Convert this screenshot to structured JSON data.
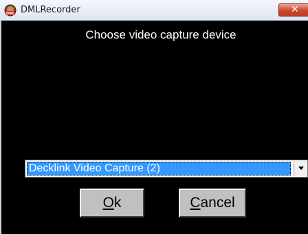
{
  "window": {
    "title": "DMLRecorder",
    "app_icon": "dml-recorder-icon",
    "close_glyph": "✕"
  },
  "dialog": {
    "heading": "Choose video capture device",
    "device_select": {
      "selected": "Decklink Video Capture (2)"
    },
    "buttons": {
      "ok": {
        "mnemonic": "O",
        "rest": "k"
      },
      "cancel": {
        "mnemonic": "C",
        "rest": "ancel"
      }
    }
  },
  "colors": {
    "background": "#000000",
    "selection": "#3399ff",
    "button_face": "#c0c0c0",
    "close_button": "#c9452b"
  }
}
